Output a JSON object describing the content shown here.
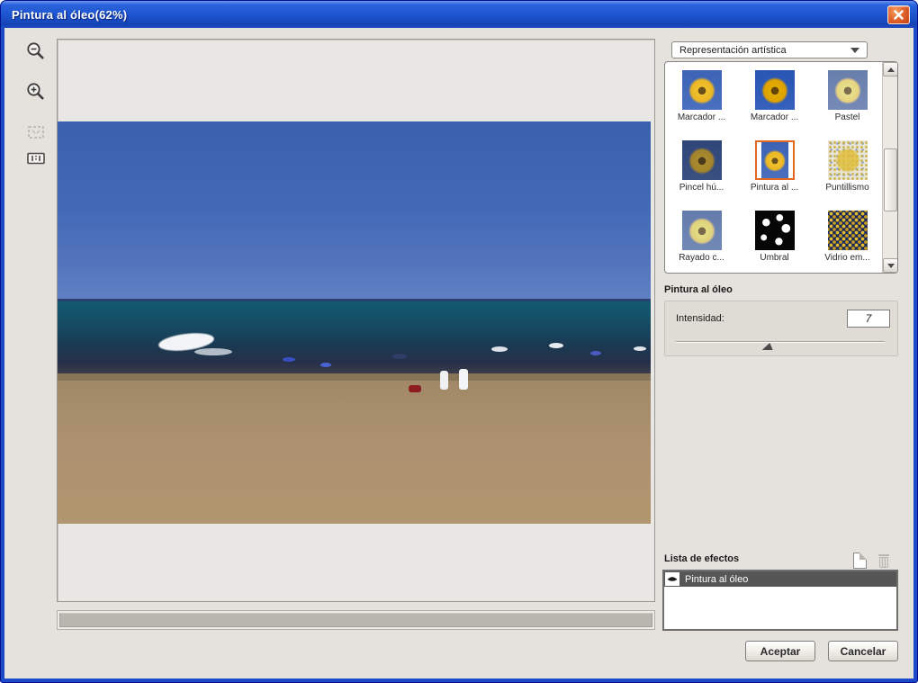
{
  "window": {
    "title": "Pintura al óleo(62%)"
  },
  "left_toolbar": {
    "icons": [
      "zoom-out",
      "zoom-in",
      "fit-on-screen",
      "actual-size"
    ]
  },
  "filter_panel": {
    "category_dropdown": "Representación artística",
    "thumbnails": [
      {
        "label": "Marcador ...",
        "selected": false
      },
      {
        "label": "Marcador ...",
        "selected": false
      },
      {
        "label": "Pastel",
        "selected": false
      },
      {
        "label": "Pincel hú...",
        "selected": false
      },
      {
        "label": "Pintura al ...",
        "selected": true
      },
      {
        "label": "Puntillismo",
        "selected": false
      },
      {
        "label": "Rayado c...",
        "selected": false
      },
      {
        "label": "Umbral",
        "selected": false
      },
      {
        "label": "Vidrio em...",
        "selected": false
      }
    ]
  },
  "settings": {
    "section_title": "Pintura al óleo",
    "intensity_label": "Intensidad:",
    "intensity_value": "7",
    "slider_percent": 40
  },
  "effects": {
    "title": "Lista de efectos",
    "items": [
      {
        "label": "Pintura al óleo",
        "visible": true
      }
    ]
  },
  "footer": {
    "accept_label": "Aceptar",
    "cancel_label": "Cancelar"
  },
  "colors": {
    "titlebar": "#2a64dc",
    "frame": "#1b49c8",
    "selection_border": "#e56821",
    "sky": "#4268b6",
    "sea": "#154a62",
    "sand": "#ab9170"
  }
}
